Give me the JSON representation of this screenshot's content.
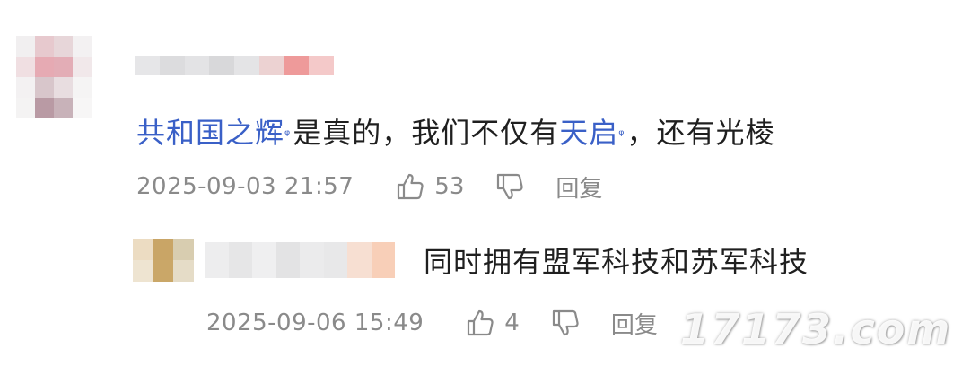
{
  "comment": {
    "link1": "共和国之辉",
    "text1": "是真的，我们不仅有",
    "link2": "天启",
    "text2": "，还有光棱",
    "timestamp": "2025-09-03 21:57",
    "likes": "53",
    "reply_label": "回复"
  },
  "reply": {
    "text": "同时拥有盟军科技和苏军科技",
    "timestamp": "2025-09-06 15:49",
    "likes": "4",
    "reply_label": "回复"
  },
  "watermark": "17173.com",
  "colors": {
    "link": "#3a60c7",
    "meta_gray": "#8a8a8a",
    "text": "#1f1f1f"
  },
  "icons": {
    "search_marker": "q-icon",
    "like": "thumb-up-icon",
    "dislike": "thumb-down-icon"
  }
}
